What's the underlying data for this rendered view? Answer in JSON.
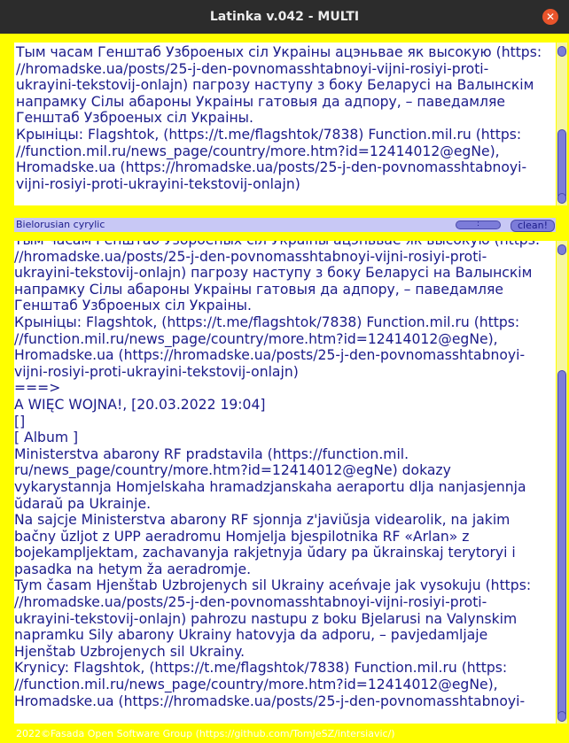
{
  "window": {
    "title": "Latinka v.042 - MULTI"
  },
  "input_pane": {
    "lines": [
      "Тым часам Генштаб Узброеных сіл Украіны ацэньвае як высокую (https:",
      "//hromadske.ua/posts/25-j-den-povnomasshtabnoyi-vijni-rosiyi-proti-",
      "ukrayini-tekstovij-onlajn) пагрозу наступу з боку Беларусі на Валынскім",
      "напрамку Сілы абароны Украіны гатовыя да адпору, – паведамляе",
      "Генштаб Узброеных сіл Украіны.",
      "Крыніцы: Flagshtok, (https://t.me/flagshtok/7838) Function.mil.ru (https:",
      "//function.mil.ru/news_page/country/more.htm?id=12414012@egNe),",
      "Hromadske.ua (https://hromadske.ua/posts/25-j-den-povnomasshtabnoyi-",
      "vijni-rosiyi-proti-ukrayini-tekstovij-onlajn)"
    ]
  },
  "controls": {
    "mode_label": "Bielorusian cyrylic",
    "separator_label": ":",
    "clean_label": "clean!"
  },
  "output_pane": {
    "lines": [
      "Тым часам Генштаб Узброеных сіл Украіны ацэньвае як высокую (https:",
      "//hromadske.ua/posts/25-j-den-povnomasshtabnoyi-vijni-rosiyi-proti-",
      "ukrayini-tekstovij-onlajn) пагрозу наступу з боку Беларусі на Валынскім",
      "напрамку Сілы абароны Украіны гатовыя да адпору, – паведамляе",
      "Генштаб Узброеных сіл Украіны.",
      "Крыніцы: Flagshtok, (https://t.me/flagshtok/7838) Function.mil.ru (https:",
      "//function.mil.ru/news_page/country/more.htm?id=12414012@egNe),",
      "Hromadske.ua (https://hromadske.ua/posts/25-j-den-povnomasshtabnoyi-",
      "vijni-rosiyi-proti-ukrayini-tekstovij-onlajn)",
      "===>",
      "A WIĘC WOJNA!, [20.03.2022 19:04]",
      "[]",
      "[ Album ]",
      "Ministerstva abarony RF pradstavila (https://function.mil.",
      "ru/news_page/country/more.htm?id=12414012@egNe) dokazy",
      "vykarystannja Homjelskaha hramadzjanskaha aeraportu dlja nanjasjennja",
      "ŭdaraŭ pa Ukrainje.",
      "Na sajcje Ministerstva abarony RF sjonnja z'javiŭsja videarolik, na jakim",
      "bačny ŭzljot z UPP aeradromu Homjelja bjespilotnika RF «Arlan» z",
      "bojekampljektam, zachavanyja rakjetnyja ŭdary pa ŭkrainskaj terytoryi i",
      "pasadka na hetym ža aeradromje.",
      "Tym časam Hjenštab Uzbrojenych sil Ukrainy aceńvaje jak vysokuju (https:",
      "//hromadske.ua/posts/25-j-den-povnomasshtabnoyi-vijni-rosiyi-proti-",
      "ukrayini-tekstovij-onlajn) pahrozu nastupu z boku Bjelarusi na Valynskim",
      "napramku Sily abarony Ukrainy hatovyja da adporu, – pavjedamljaje",
      "Hjenštab Uzbrojenych sil Ukrainy.",
      "Krynicy: Flagshtok, (https://t.me/flagshtok/7838) Function.mil.ru (https:",
      "//function.mil.ru/news_page/country/more.htm?id=12414012@egNe),",
      "Hromadske.ua (https://hromadske.ua/posts/25-j-den-povnomasshtabnoyi-"
    ]
  },
  "footer": {
    "text": "2022©Fasada Open Software Group (https://github.com/TomJeSZ/intersiavic/)"
  },
  "colors": {
    "frame": "#ffff00",
    "text": "#1b1b8a",
    "button": "#7c7cd9",
    "titlebar": "#2c2c2c"
  }
}
